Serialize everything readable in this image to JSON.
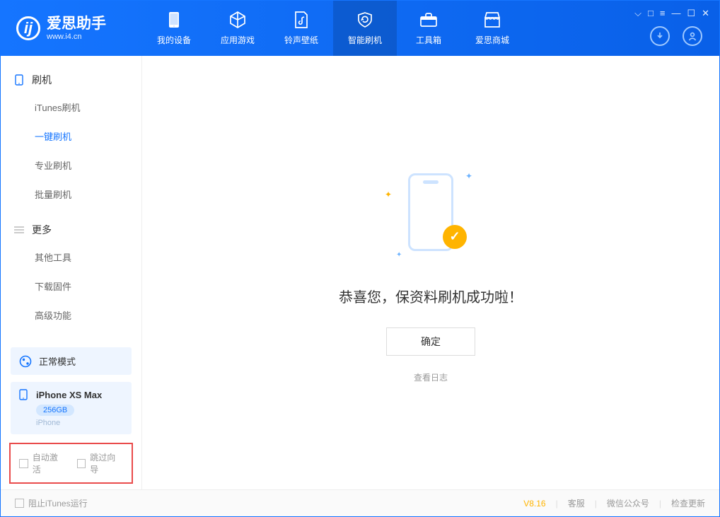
{
  "app": {
    "name": "爱思助手",
    "site": "www.i4.cn"
  },
  "nav": {
    "items": [
      {
        "label": "我的设备"
      },
      {
        "label": "应用游戏"
      },
      {
        "label": "铃声壁纸"
      },
      {
        "label": "智能刷机"
      },
      {
        "label": "工具箱"
      },
      {
        "label": "爱思商城"
      }
    ]
  },
  "sidebar": {
    "section_flash": "刷机",
    "flash_items": [
      {
        "label": "iTunes刷机"
      },
      {
        "label": "一键刷机"
      },
      {
        "label": "专业刷机"
      },
      {
        "label": "批量刷机"
      }
    ],
    "section_more": "更多",
    "more_items": [
      {
        "label": "其他工具"
      },
      {
        "label": "下载固件"
      },
      {
        "label": "高级功能"
      }
    ],
    "mode_label": "正常模式",
    "device": {
      "name": "iPhone XS Max",
      "storage": "256GB",
      "type": "iPhone"
    },
    "cb_auto_activate": "自动激活",
    "cb_skip_guide": "跳过向导"
  },
  "main": {
    "success_text": "恭喜您，保资料刷机成功啦！",
    "ok_button": "确定",
    "view_log": "查看日志"
  },
  "footer": {
    "block_itunes": "阻止iTunes运行",
    "version": "V8.16",
    "customer_service": "客服",
    "wechat": "微信公众号",
    "check_update": "检查更新"
  }
}
